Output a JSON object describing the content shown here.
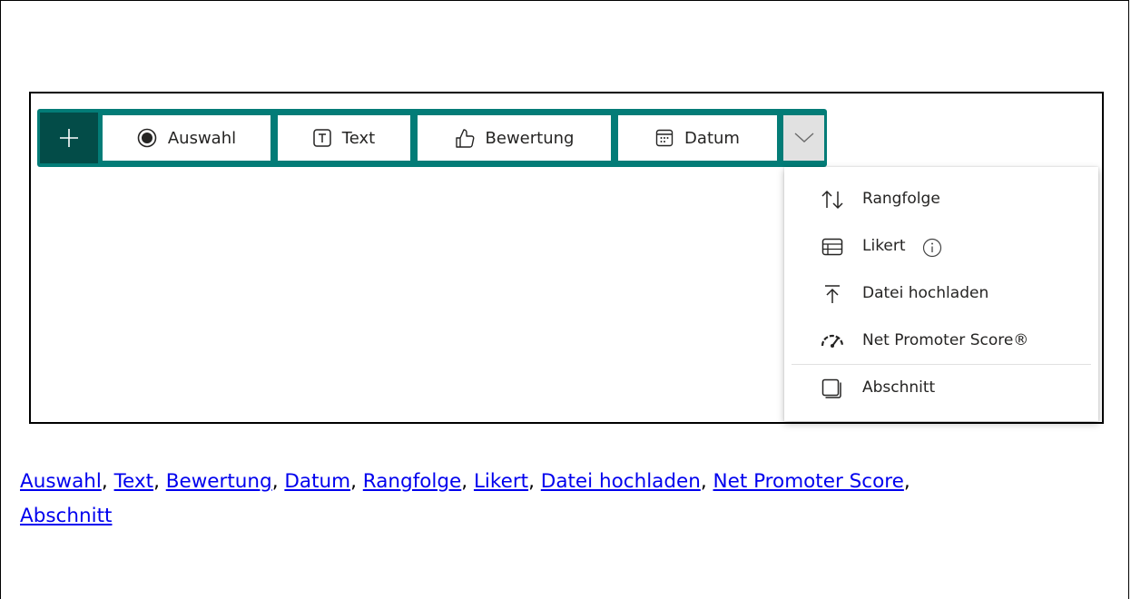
{
  "toolbar": {
    "buttons": [
      {
        "label": "Auswahl",
        "icon": "radio-button-icon"
      },
      {
        "label": "Text",
        "icon": "text-box-icon"
      },
      {
        "label": "Bewertung",
        "icon": "thumbs-up-icon"
      },
      {
        "label": "Datum",
        "icon": "calendar-icon"
      }
    ]
  },
  "menu": {
    "items": [
      {
        "label": "Rangfolge",
        "icon": "ranking-arrows-icon"
      },
      {
        "label": "Likert",
        "icon": "likert-grid-icon"
      },
      {
        "label": "Datei hochladen",
        "icon": "upload-icon"
      },
      {
        "label": "Net Promoter Score®",
        "icon": "gauge-icon"
      },
      {
        "label": "Abschnitt",
        "icon": "section-icon"
      }
    ]
  },
  "links": {
    "items": [
      "Auswahl",
      "Text",
      "Bewertung",
      "Datum",
      "Rangfolge",
      "Likert",
      "Datei hochladen",
      "Net Promoter Score",
      "Abschnitt"
    ],
    "separator": ", "
  },
  "colors": {
    "toolbar_bg": "#037c77",
    "add_button_bg": "#034c48",
    "link": "#0000ee"
  }
}
